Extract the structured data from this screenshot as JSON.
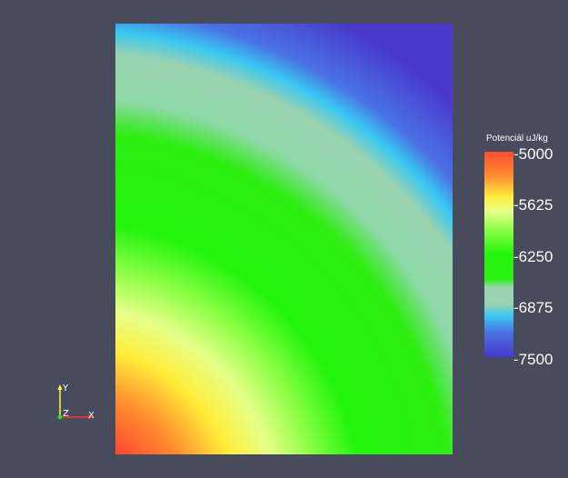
{
  "scalar_bar": {
    "title": "Potenciál uJ/kg",
    "ticks": [
      "-5000",
      "-5625",
      "-6250",
      "-6875",
      "-7500"
    ],
    "colors": {
      "max": "#ff4b2e",
      "orange": "#ff8f2e",
      "yellow": "#ffee3a",
      "pale_yellow": "#e6ff88",
      "light_green": "#8cff45",
      "green": "#22f50c",
      "pale_teal": "#9ad3b0",
      "cyan": "#38c8f2",
      "blue": "#4a72e4",
      "min": "#4838cc"
    }
  },
  "axes": {
    "x_label": "X",
    "y_label": "Y",
    "z_label": "Z"
  }
}
